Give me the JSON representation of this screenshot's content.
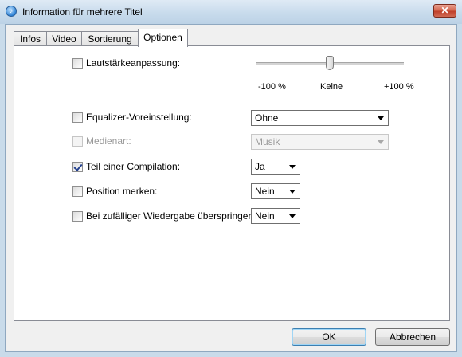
{
  "window": {
    "title": "Information für mehrere Titel",
    "close_label": "✕"
  },
  "tabs": [
    {
      "label": "Infos",
      "active": false
    },
    {
      "label": "Video",
      "active": false
    },
    {
      "label": "Sortierung",
      "active": false
    },
    {
      "label": "Optionen",
      "active": true
    }
  ],
  "options": {
    "volume": {
      "label": "Lautstärkeanpassung:",
      "checked": false,
      "slider_level_percent": 0,
      "tick_min": "-100 %",
      "tick_mid": "Keine",
      "tick_max": "+100 %"
    },
    "equalizer": {
      "label": "Equalizer-Voreinstellung:",
      "checked": false,
      "value": "Ohne"
    },
    "media_type": {
      "label": "Medienart:",
      "checked": false,
      "disabled": true,
      "value": "Musik"
    },
    "compilation": {
      "label": "Teil einer Compilation:",
      "checked": true,
      "value": "Ja"
    },
    "remember_position": {
      "label": "Position merken:",
      "checked": false,
      "value": "Nein"
    },
    "skip_shuffle": {
      "label": "Bei zufälliger Wiedergabe überspringen:",
      "checked": false,
      "value": "Nein"
    }
  },
  "buttons": {
    "ok_label": "OK",
    "cancel_label": "Abbrechen"
  }
}
